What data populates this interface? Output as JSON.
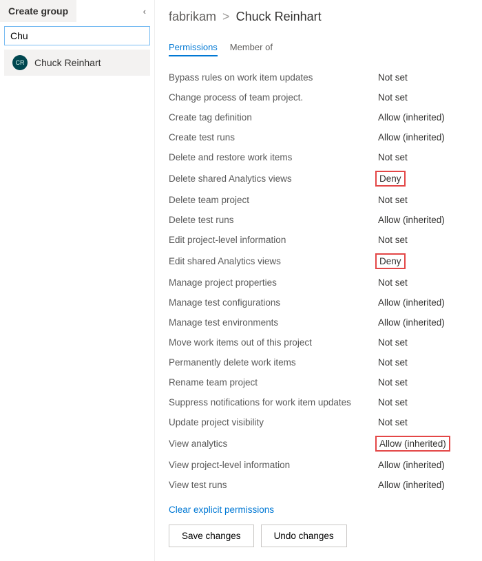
{
  "leftPanel": {
    "createGroupLabel": "Create group",
    "searchValue": "Chu",
    "userAvatarInitials": "CR",
    "userName": "Chuck Reinhart"
  },
  "breadcrumb": {
    "parent": "fabrikam",
    "separator": ">",
    "current": "Chuck Reinhart"
  },
  "tabs": {
    "permissions": "Permissions",
    "memberOf": "Member of"
  },
  "permissions": [
    {
      "label": "Bypass rules on work item updates",
      "value": "Not set",
      "highlight": false
    },
    {
      "label": "Change process of team project.",
      "value": "Not set",
      "highlight": false
    },
    {
      "label": "Create tag definition",
      "value": "Allow (inherited)",
      "highlight": false
    },
    {
      "label": "Create test runs",
      "value": "Allow (inherited)",
      "highlight": false
    },
    {
      "label": "Delete and restore work items",
      "value": "Not set",
      "highlight": false
    },
    {
      "label": "Delete shared Analytics views",
      "value": "Deny",
      "highlight": true
    },
    {
      "label": "Delete team project",
      "value": "Not set",
      "highlight": false
    },
    {
      "label": "Delete test runs",
      "value": "Allow (inherited)",
      "highlight": false
    },
    {
      "label": "Edit project-level information",
      "value": "Not set",
      "highlight": false
    },
    {
      "label": "Edit shared Analytics views",
      "value": "Deny",
      "highlight": true
    },
    {
      "label": "Manage project properties",
      "value": "Not set",
      "highlight": false
    },
    {
      "label": "Manage test configurations",
      "value": "Allow (inherited)",
      "highlight": false
    },
    {
      "label": "Manage test environments",
      "value": "Allow (inherited)",
      "highlight": false
    },
    {
      "label": "Move work items out of this project",
      "value": "Not set",
      "highlight": false
    },
    {
      "label": "Permanently delete work items",
      "value": "Not set",
      "highlight": false
    },
    {
      "label": "Rename team project",
      "value": "Not set",
      "highlight": false
    },
    {
      "label": "Suppress notifications for work item updates",
      "value": "Not set",
      "highlight": false
    },
    {
      "label": "Update project visibility",
      "value": "Not set",
      "highlight": false
    },
    {
      "label": "View analytics",
      "value": "Allow (inherited)",
      "highlight": true
    },
    {
      "label": "View project-level information",
      "value": "Allow (inherited)",
      "highlight": false
    },
    {
      "label": "View test runs",
      "value": "Allow (inherited)",
      "highlight": false
    }
  ],
  "actions": {
    "clearLink": "Clear explicit permissions",
    "saveButton": "Save changes",
    "undoButton": "Undo changes"
  }
}
